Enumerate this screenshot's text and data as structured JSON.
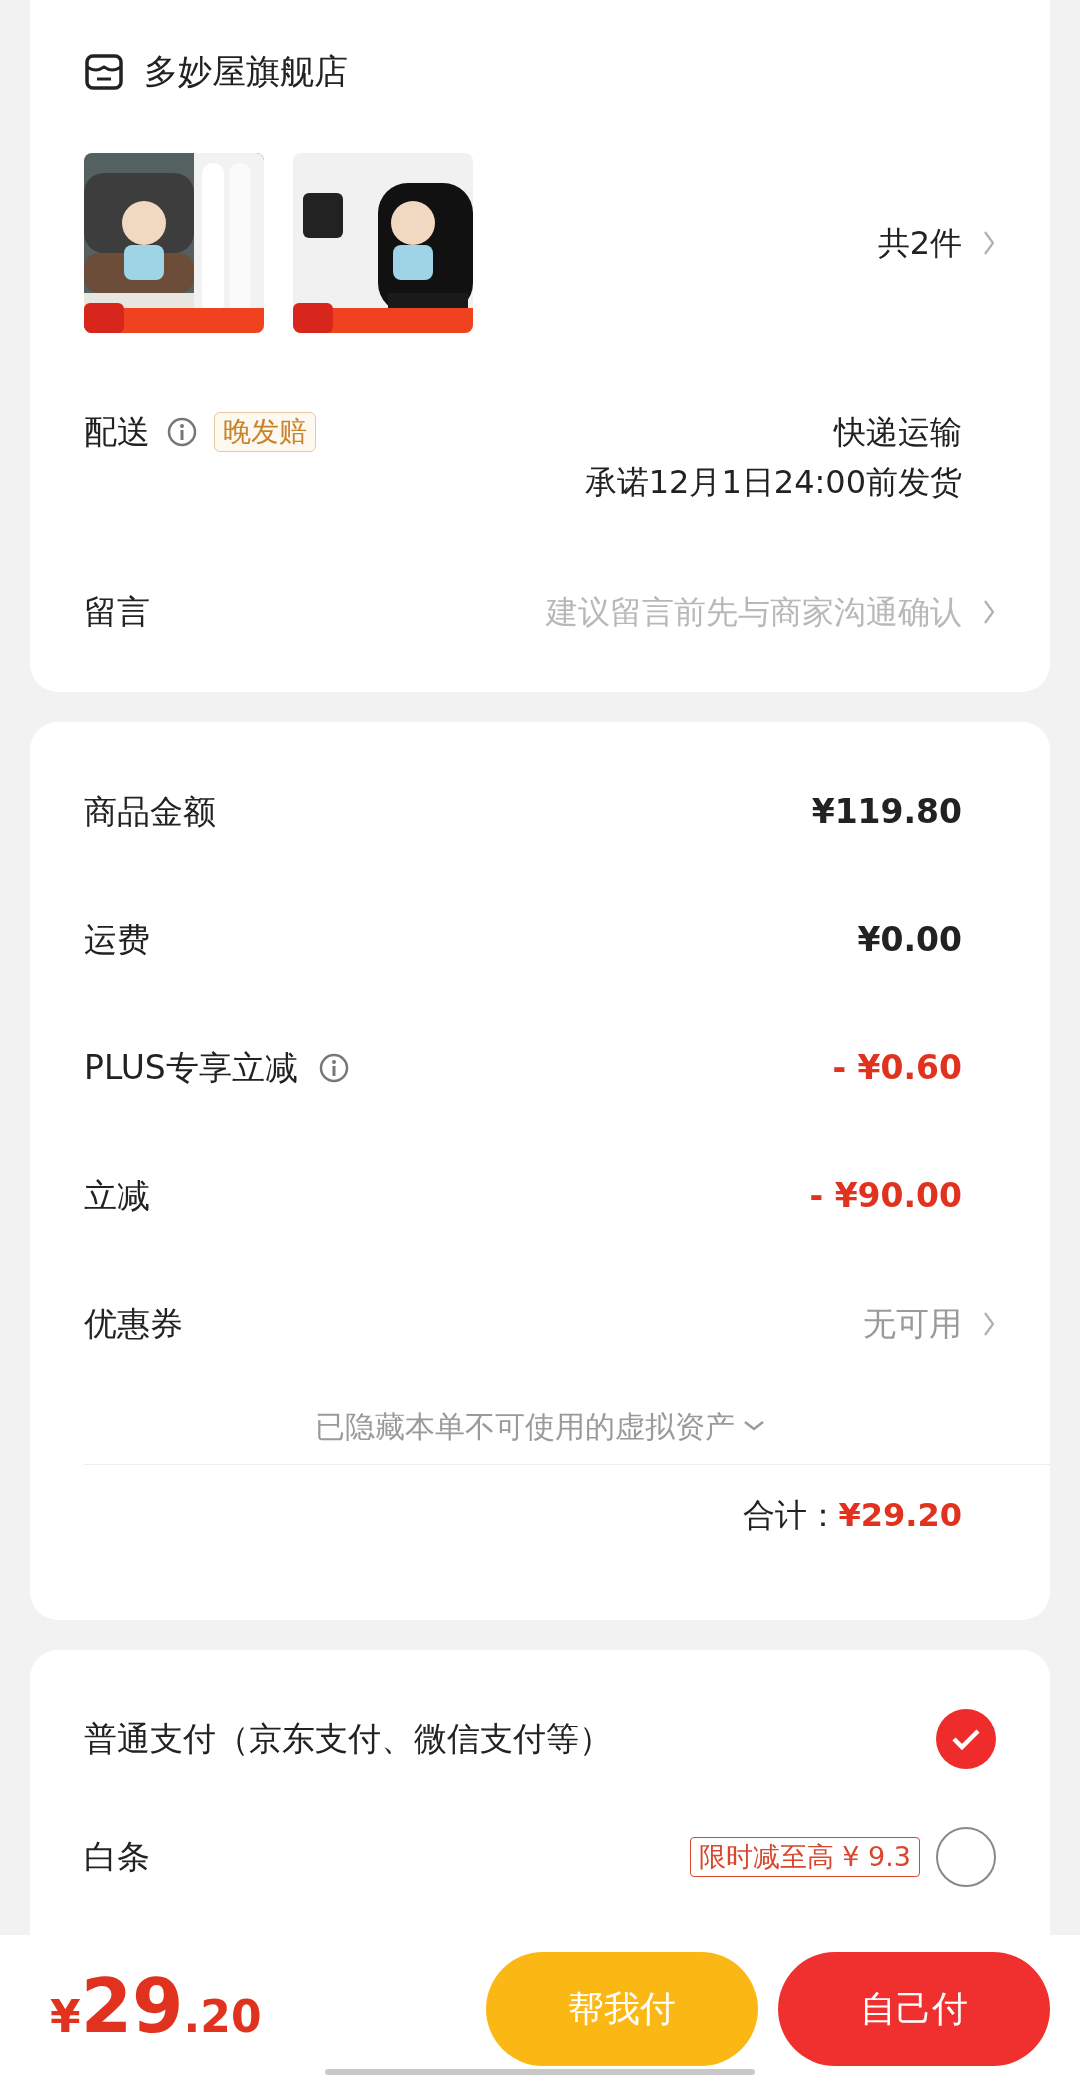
{
  "shop": {
    "name": "多妙屋旗舰店"
  },
  "products": {
    "count": "共2件"
  },
  "delivery": {
    "label": "配送",
    "badge": "晚发赔",
    "method": "快递运输",
    "promise": "承诺12月1日24:00前发货"
  },
  "message": {
    "label": "留言",
    "placeholder": "建议留言前先与商家沟通确认"
  },
  "amounts": [
    {
      "label": "商品金额",
      "value": "¥119.80",
      "kind": "plain",
      "info": false
    },
    {
      "label": "运费",
      "value": "¥0.00",
      "kind": "plain",
      "info": false
    },
    {
      "label": "PLUS专享立减",
      "value": "- ¥0.60",
      "kind": "discount",
      "info": true
    },
    {
      "label": "立减",
      "value": "- ¥90.00",
      "kind": "discount",
      "info": false
    },
    {
      "label": "优惠券",
      "value": "无可用",
      "kind": "link",
      "info": false
    }
  ],
  "hidden_assets": "已隐藏本单不可使用的虚拟资产",
  "total": {
    "label": "合计：",
    "value": "¥29.20"
  },
  "payment_methods": [
    {
      "label": "普通支付（京东支付、微信支付等）",
      "selected": true
    },
    {
      "label": "白条",
      "badge": "限时减至高 ¥ 9.3",
      "selected": false
    }
  ],
  "bottom_bar": {
    "currency": "¥",
    "price_int": "29",
    "price_dec": ".20",
    "buttons": [
      {
        "label": "帮我付",
        "kind": "secondary"
      },
      {
        "label": "自己付",
        "kind": "primary"
      }
    ]
  }
}
